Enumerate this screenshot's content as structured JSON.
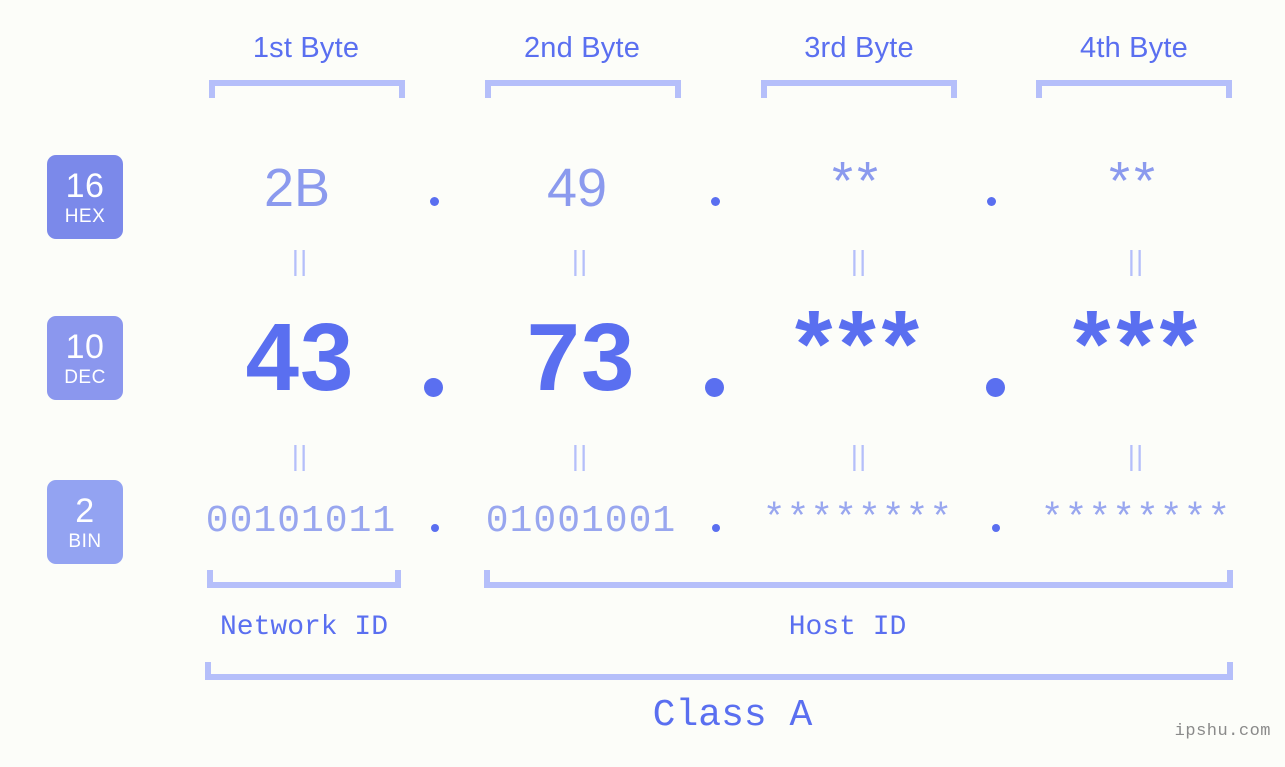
{
  "background_color": "#fcfdf9",
  "accent_color": "#5a6ff0",
  "accent_light_color": "#b5bffa",
  "accent_mid_color": "#8b9aee",
  "headers": {
    "byte1": "1st Byte",
    "byte2": "2nd Byte",
    "byte3": "3rd Byte",
    "byte4": "4th Byte"
  },
  "radix_badges": [
    {
      "number": "16",
      "unit": "HEX",
      "color": "#7b89ea"
    },
    {
      "number": "10",
      "unit": "DEC",
      "color": "#8b97ee"
    },
    {
      "number": "2",
      "unit": "BIN",
      "color": "#93a3f2"
    }
  ],
  "rows": {
    "hex": {
      "label": "HEX",
      "values": [
        "2B",
        "49",
        "**",
        "**"
      ],
      "separator": "."
    },
    "dec": {
      "label": "DEC",
      "values": [
        "43",
        "73",
        "***",
        "***"
      ],
      "separator": "."
    },
    "bin": {
      "label": "BIN",
      "values": [
        "00101011",
        "01001001",
        "********",
        "********"
      ],
      "separator": "."
    }
  },
  "equals_symbol": "||",
  "segments": {
    "network_id": "Network ID",
    "host_id": "Host ID",
    "class": "Class A"
  },
  "watermark": "ipshu.com"
}
